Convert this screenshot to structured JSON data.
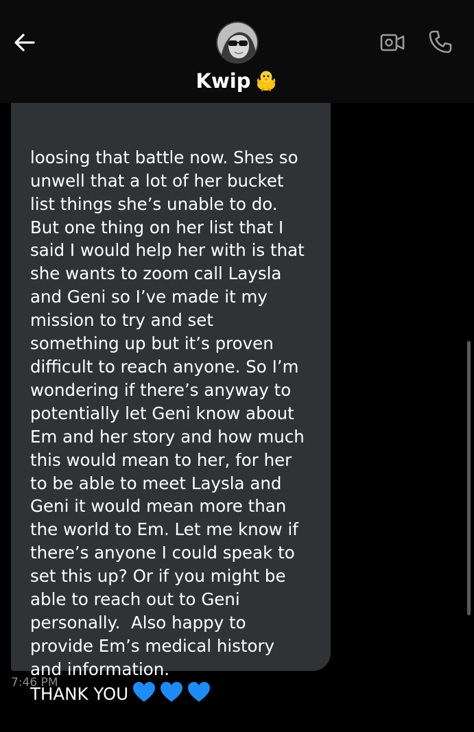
{
  "header": {
    "contact_name": "Kwip",
    "name_emoji": "baby-chick-emoji",
    "back_icon": "arrow-left-icon",
    "video_icon": "video-camera-icon",
    "call_icon": "phone-icon"
  },
  "message": {
    "lines": [
      "loosing that battle now. Shes so",
      "unwell that a lot of her bucket",
      "list things she’s unable to do.",
      "But one thing on her list that I",
      "said I would help her with is that",
      "she wants to zoom call Laysla",
      "and Geni so I’ve made it my",
      "mission to try and set",
      "something up but it’s proven",
      "difficult to reach anyone. So I’m",
      "wondering if there’s anyway to",
      "potentially let Geni know about",
      "Em and her story and how much",
      "this would mean to her, for her",
      "to be able to meet Laysla and",
      "Geni it would mean more than",
      "the world to Em. Let me know if",
      "there’s anyone I could speak to",
      "set this up? Or if you might be",
      "able to reach out to Geni",
      "personally.  Also happy to",
      "provide Em’s medical history",
      "and information.",
      "THANK YOU"
    ],
    "hearts": [
      "blue-heart-emoji",
      "blue-heart-emoji",
      "blue-heart-emoji"
    ],
    "timestamp": "7:46 PM"
  },
  "colors": {
    "background": "#000000",
    "header": "#0b0b0b",
    "bubble": "#2f3336",
    "heart": "#1d8cf5",
    "timestamp": "#8b8f93"
  }
}
